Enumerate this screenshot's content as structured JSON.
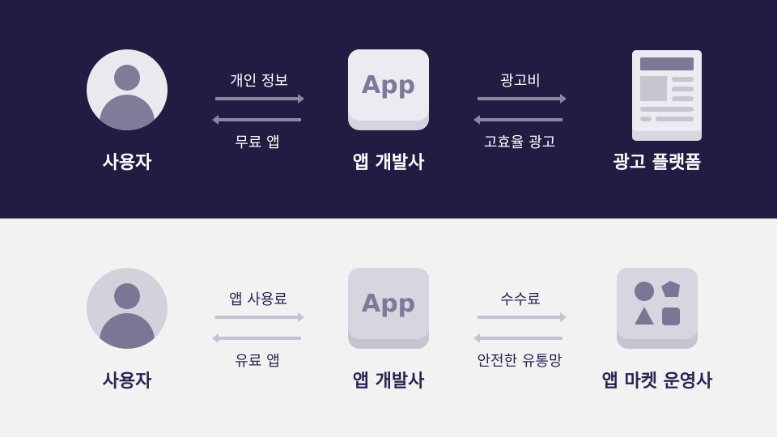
{
  "top_flow": {
    "left_node": {
      "label": "사용자",
      "icon": "user-icon"
    },
    "center_node": {
      "label": "앱 개발사",
      "icon_text": "App"
    },
    "right_node": {
      "label": "광고 플랫폼",
      "icon": "ad-document-icon"
    },
    "left_arrows": {
      "upper": "개인 정보",
      "lower": "무료 앱"
    },
    "right_arrows": {
      "upper": "광고비",
      "lower": "고효율 광고"
    }
  },
  "bottom_flow": {
    "left_node": {
      "label": "사용자",
      "icon": "user-icon"
    },
    "center_node": {
      "label": "앱 개발사",
      "icon_text": "App"
    },
    "right_node": {
      "label": "앱 마켓 운영사",
      "icon": "app-market-icon"
    },
    "left_arrows": {
      "upper": "앱 사용료",
      "lower": "유료 앱"
    },
    "right_arrows": {
      "upper": "수수료",
      "lower": "안전한 유통망"
    }
  },
  "colors": {
    "top_background": "#221b42",
    "bottom_background": "#f2f2f2",
    "icon_accent": "#7f7899"
  }
}
